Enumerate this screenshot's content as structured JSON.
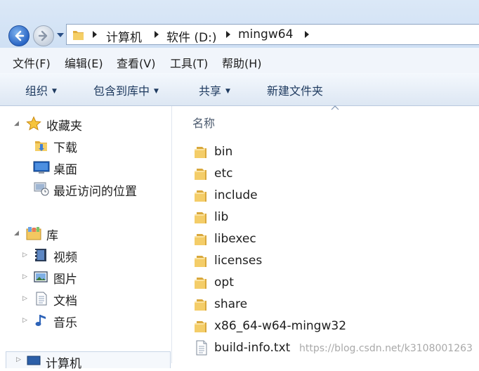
{
  "breadcrumb": [
    "计算机",
    "软件 (D:)",
    "mingw64"
  ],
  "menu": [
    "文件(F)",
    "编辑(E)",
    "查看(V)",
    "工具(T)",
    "帮助(H)"
  ],
  "commands": [
    "组织",
    "包含到库中",
    "共享",
    "新建文件夹"
  ],
  "nav": {
    "favorites": "收藏夹",
    "favorites_items": [
      "下载",
      "桌面",
      "最近访问的位置"
    ],
    "libraries": "库",
    "library_items": [
      "视频",
      "图片",
      "文档",
      "音乐"
    ],
    "computer": "计算机"
  },
  "content": {
    "column_header": "名称",
    "files": [
      {
        "name": "bin",
        "type": "folder"
      },
      {
        "name": "etc",
        "type": "folder"
      },
      {
        "name": "include",
        "type": "folder"
      },
      {
        "name": "lib",
        "type": "folder"
      },
      {
        "name": "libexec",
        "type": "folder"
      },
      {
        "name": "licenses",
        "type": "folder"
      },
      {
        "name": "opt",
        "type": "folder"
      },
      {
        "name": "share",
        "type": "folder"
      },
      {
        "name": "x86_64-w64-mingw32",
        "type": "folder"
      },
      {
        "name": "build-info.txt",
        "type": "file"
      }
    ]
  },
  "watermark": "https://blog.csdn.net/k3108001263",
  "icons": {
    "back": "back-arrow-icon",
    "forward": "forward-arrow-icon",
    "folder": "folder-icon",
    "file": "text-file-icon",
    "favorites": "star-icon"
  },
  "colors": {
    "folder": "#f2c65a",
    "back_button": "#2a66c5",
    "command_text": "#1e3a5f"
  }
}
